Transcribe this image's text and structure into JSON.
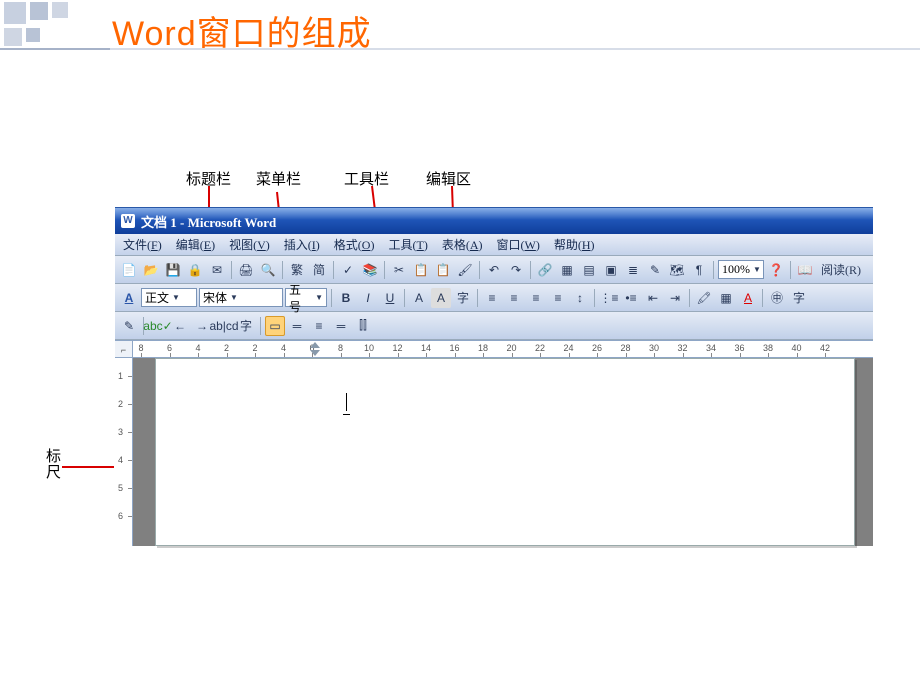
{
  "slide": {
    "title": "Word窗口的组成",
    "labels": {
      "title_bar": "标题栏",
      "menu_bar": "菜单栏",
      "toolbar": "工具栏",
      "edit_area": "编辑区",
      "ruler": "标尺"
    }
  },
  "window": {
    "title": "文档 1 - Microsoft Word",
    "menus": [
      {
        "label": "文件",
        "accel": "F"
      },
      {
        "label": "编辑",
        "accel": "E"
      },
      {
        "label": "视图",
        "accel": "V"
      },
      {
        "label": "插入",
        "accel": "I"
      },
      {
        "label": "格式",
        "accel": "O"
      },
      {
        "label": "工具",
        "accel": "T"
      },
      {
        "label": "表格",
        "accel": "A"
      },
      {
        "label": "窗口",
        "accel": "W"
      },
      {
        "label": "帮助",
        "accel": "H"
      }
    ],
    "toolbar1": {
      "zoom": "100%",
      "read_label": "阅读(R)"
    },
    "toolbar2": {
      "style": "正文",
      "font": "宋体",
      "size": "五号"
    },
    "ruler_h": {
      "ticks": [
        8,
        6,
        4,
        2,
        2,
        4,
        6,
        8,
        10,
        12,
        14,
        16,
        18,
        20,
        22,
        24,
        26,
        28,
        30,
        32,
        34,
        36,
        38,
        40,
        42
      ],
      "indent_at": 200,
      "page_edge_at": 138
    },
    "ruler_v": {
      "ticks": [
        1,
        2,
        3,
        4,
        5,
        6
      ]
    }
  }
}
